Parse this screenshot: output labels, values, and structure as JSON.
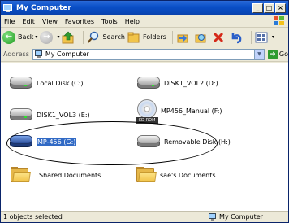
{
  "window": {
    "title": "My Computer",
    "controls": [
      "_",
      "□",
      "×"
    ]
  },
  "menu": {
    "items": [
      "File",
      "Edit",
      "View",
      "Favorites",
      "Tools",
      "Help"
    ]
  },
  "toolbar": {
    "back_label": "Back",
    "search_label": "Search",
    "folders_label": "Folders"
  },
  "address": {
    "label": "Address",
    "value": "My Computer",
    "go_label": "Go"
  },
  "items": {
    "local_disk_c": "Local Disk (C:)",
    "disk1_vol2_d": "DISK1_VOL2 (D:)",
    "disk1_vol3_e": "DISK1_VOL3 (E:)",
    "mp456_manual_f": "MP456_Manual (F:)",
    "cd_rom_tag": "CD-ROM",
    "mp456_g": "MP-456 (G:)",
    "removable_h": "Removable Disk (H:)",
    "shared_documents": "Shared Documents",
    "user_documents": "sae's Documents"
  },
  "status": {
    "left": "1 objects selected",
    "right": "My Computer"
  },
  "colors": {
    "selection": "#316ac5",
    "titlebar": "#0a4fc7"
  }
}
